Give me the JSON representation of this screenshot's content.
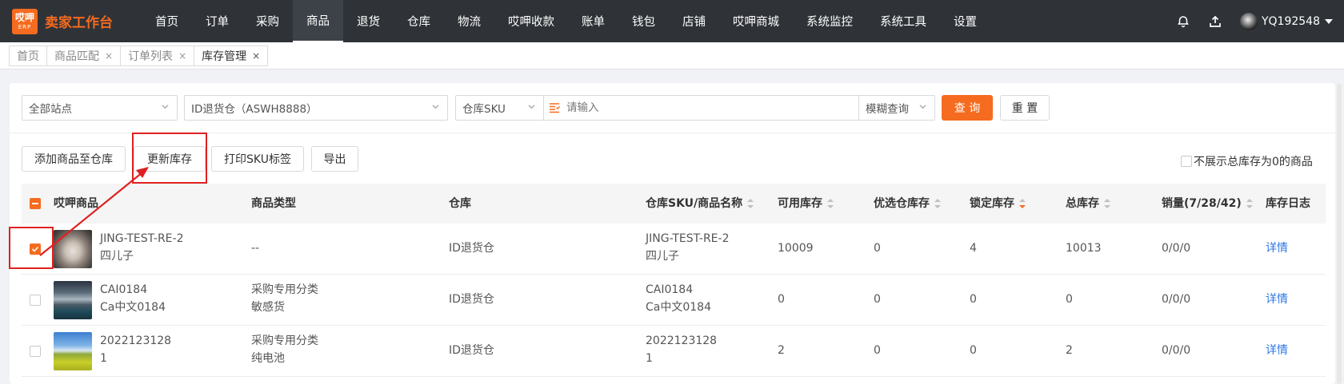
{
  "header": {
    "logo_top": "哎呷",
    "logo_bottom": "ERP",
    "app_title": "卖家工作台",
    "nav": [
      "首页",
      "订单",
      "采购",
      "商品",
      "退货",
      "仓库",
      "物流",
      "哎呷收款",
      "账单",
      "钱包",
      "店铺",
      "哎呷商城",
      "系统监控",
      "系统工具",
      "设置"
    ],
    "active_nav": "商品",
    "username": "YQ192548"
  },
  "tabs": [
    {
      "label": "首页",
      "closable": false
    },
    {
      "label": "商品匹配",
      "closable": true
    },
    {
      "label": "订单列表",
      "closable": true
    },
    {
      "label": "库存管理",
      "closable": true,
      "active": true
    }
  ],
  "filters": {
    "site": "全部站点",
    "warehouse": "ID退货仓（ASWH8888）",
    "field": "仓库SKU",
    "search_placeholder": "请输入",
    "match_mode": "模糊查询",
    "query_label": "查 询",
    "reset_label": "重 置"
  },
  "actions": {
    "add": "添加商品至仓库",
    "update": "更新库存",
    "print": "打印SKU标签",
    "export": "导出",
    "hide_zero": "不展示总库存为0的商品"
  },
  "table": {
    "columns": [
      "哎呷商品",
      "商品类型",
      "仓库",
      "仓库SKU/商品名称",
      "可用库存",
      "优选仓库存",
      "锁定库存",
      "总库存",
      "销量(7/28/42)",
      "库存日志"
    ],
    "rows": [
      {
        "checked": true,
        "name1": "JING-TEST-RE-2",
        "name2": "四儿子",
        "type1": "--",
        "type2": "",
        "warehouse": "ID退货仓",
        "sku1": "JING-TEST-RE-2",
        "sku2": "四儿子",
        "available": "10009",
        "preferred": "0",
        "locked": "4",
        "total": "10013",
        "sales": "0/0/0",
        "log": "详情"
      },
      {
        "checked": false,
        "name1": "CAI0184",
        "name2": "Ca中文0184",
        "type1": "采购专用分类",
        "type2": "敏感货",
        "warehouse": "ID退货仓",
        "sku1": "CAI0184",
        "sku2": "Ca中文0184",
        "available": "0",
        "preferred": "0",
        "locked": "0",
        "total": "0",
        "sales": "0/0/0",
        "log": "详情"
      },
      {
        "checked": false,
        "name1": "2022123128",
        "name2": "1",
        "type1": "采购专用分类",
        "type2": "纯电池",
        "warehouse": "ID退货仓",
        "sku1": "2022123128",
        "sku2": "1",
        "available": "2",
        "preferred": "0",
        "locked": "0",
        "total": "2",
        "sales": "0/0/0",
        "log": "详情"
      }
    ]
  },
  "colors": {
    "accent": "#f56b1f",
    "topbar": "#2f3338",
    "link": "#2d76e8",
    "annotation": "#e02020"
  }
}
